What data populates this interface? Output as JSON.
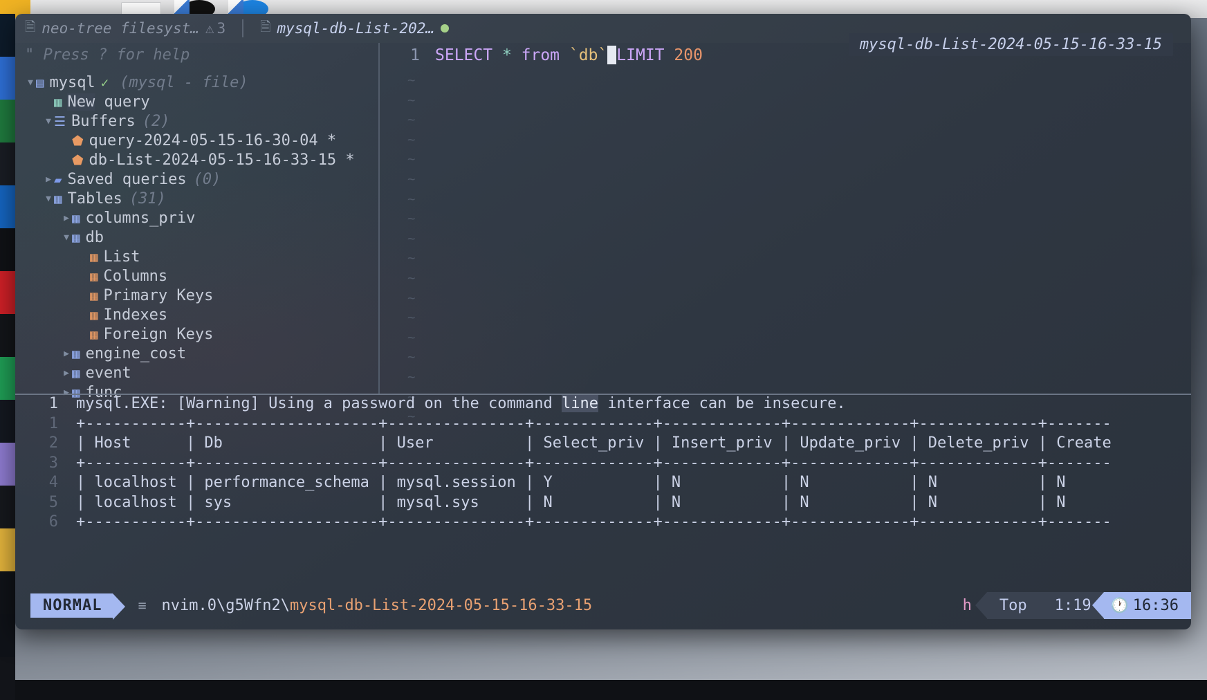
{
  "tabline": {
    "tabs": [
      {
        "icon": "file-icon",
        "label": "neo-tree filesyst…",
        "badge": "3",
        "badge_icon": "warning-icon",
        "active": false
      },
      {
        "icon": "file-icon",
        "label": "mysql-db-List-202…",
        "modified_icon": "green-dot-icon",
        "active": true
      }
    ]
  },
  "sidebar": {
    "help_hint": "\" Press ? for help",
    "items": [
      {
        "indent": 0,
        "chevron": "▼",
        "icon": "database-icon",
        "icon_class": "blue",
        "label": "mysql",
        "check": "✓",
        "note": "(mysql - file)"
      },
      {
        "indent": 1,
        "chevron": "",
        "icon": "new-query-icon",
        "icon_class": "teal",
        "label": "New query",
        "highlight_word": "New"
      },
      {
        "indent": 1,
        "chevron": "▼",
        "icon": "list-icon",
        "icon_class": "blue",
        "label": "Buffers",
        "note": "(2)"
      },
      {
        "indent": 2,
        "chevron": "",
        "icon": "buffer-icon",
        "icon_class": "orange",
        "label": "query-2024-05-15-16-30-04 *"
      },
      {
        "indent": 2,
        "chevron": "",
        "icon": "buffer-icon",
        "icon_class": "orange",
        "label": "db-List-2024-05-15-16-33-15 *"
      },
      {
        "indent": 1,
        "chevron": "▶",
        "icon": "folder-icon",
        "icon_class": "folder",
        "label": "Saved queries",
        "note": "(0)"
      },
      {
        "indent": 1,
        "chevron": "▼",
        "icon": "table-icon",
        "icon_class": "blue",
        "label": "Tables",
        "note": "(31)"
      },
      {
        "indent": 2,
        "chevron": "▶",
        "icon": "table-icon",
        "icon_class": "blue",
        "label": "columns_priv"
      },
      {
        "indent": 2,
        "chevron": "▼",
        "icon": "table-icon",
        "icon_class": "blue",
        "label": "db"
      },
      {
        "indent": 3,
        "chevron": "",
        "icon": "table-icon",
        "icon_class": "orange",
        "label": "List"
      },
      {
        "indent": 3,
        "chevron": "",
        "icon": "table-icon",
        "icon_class": "orange",
        "label": "Columns"
      },
      {
        "indent": 3,
        "chevron": "",
        "icon": "table-icon",
        "icon_class": "orange",
        "label": "Primary Keys"
      },
      {
        "indent": 3,
        "chevron": "",
        "icon": "table-icon",
        "icon_class": "orange",
        "label": "Indexes"
      },
      {
        "indent": 3,
        "chevron": "",
        "icon": "table-icon",
        "icon_class": "orange",
        "label": "Foreign Keys"
      },
      {
        "indent": 2,
        "chevron": "▶",
        "icon": "table-icon",
        "icon_class": "blue",
        "label": "engine_cost"
      },
      {
        "indent": 2,
        "chevron": "▶",
        "icon": "table-icon",
        "icon_class": "blue",
        "label": "event"
      },
      {
        "indent": 2,
        "chevron": "▶",
        "icon": "table-icon",
        "icon_class": "blue",
        "label": "func"
      }
    ]
  },
  "editor": {
    "line_number": "1",
    "tokens": [
      {
        "text": "SELECT ",
        "class": "kw"
      },
      {
        "text": "* ",
        "class": "star"
      },
      {
        "text": "from ",
        "class": "kw"
      },
      {
        "text": "`db`",
        "class": "ident"
      },
      {
        "text": "CURSOR",
        "class": "cursor"
      },
      {
        "text": "LIMIT ",
        "class": "kw"
      },
      {
        "text": "200",
        "class": "num"
      }
    ],
    "plain_text": "SELECT * from `db` LIMIT 200",
    "tilde_char": "~",
    "tilde_rows": 18,
    "float_label": "mysql-db-List-2024-05-15-16-33-15"
  },
  "output": {
    "lines": [
      {
        "num": "1",
        "current": true,
        "segments": [
          {
            "text": "mysql.EXE: [Warning] Using a password on the command ",
            "mark": false
          },
          {
            "text": "line",
            "mark": true
          },
          {
            "text": " interface can be insecure.",
            "mark": false
          }
        ]
      },
      {
        "num": "1",
        "current": false,
        "segments": [
          {
            "text": "+-----------+--------------------+---------------+-------------+-------------+-------------+-------------+-------",
            "mark": false
          }
        ]
      },
      {
        "num": "2",
        "current": false,
        "segments": [
          {
            "text": "| Host      | Db                 | User          | Select_priv | Insert_priv | Update_priv | Delete_priv | Create",
            "mark": false
          }
        ]
      },
      {
        "num": "3",
        "current": false,
        "segments": [
          {
            "text": "+-----------+--------------------+---------------+-------------+-------------+-------------+-------------+-------",
            "mark": false
          }
        ]
      },
      {
        "num": "4",
        "current": false,
        "segments": [
          {
            "text": "| localhost | performance_schema | mysql.session | Y           | N           | N           | N           | N",
            "mark": false
          }
        ]
      },
      {
        "num": "5",
        "current": false,
        "segments": [
          {
            "text": "| localhost | sys                | mysql.sys     | N           | N           | N           | N           | N",
            "mark": false
          }
        ]
      },
      {
        "num": "6",
        "current": false,
        "segments": [
          {
            "text": "+-----------+--------------------+---------------+-------------+-------------+-------------+-------------+-------",
            "mark": false
          }
        ]
      }
    ]
  },
  "statusline": {
    "mode": "NORMAL",
    "bars_icon": "lines-icon",
    "path_prefix": "nvim.0\\g5Wfn2\\",
    "path_file": "mysql-db-List-2024-05-15-16-33-15",
    "key_hint": "h",
    "position_label": "Top",
    "position_value": "1:19",
    "clock_icon": "clock-icon",
    "clock": "16:36"
  },
  "colors": {
    "accent_blue": "#a4b8f0",
    "orange": "#e8a172",
    "green_dot": "#a6d189",
    "bg_window": "#2f3742"
  }
}
